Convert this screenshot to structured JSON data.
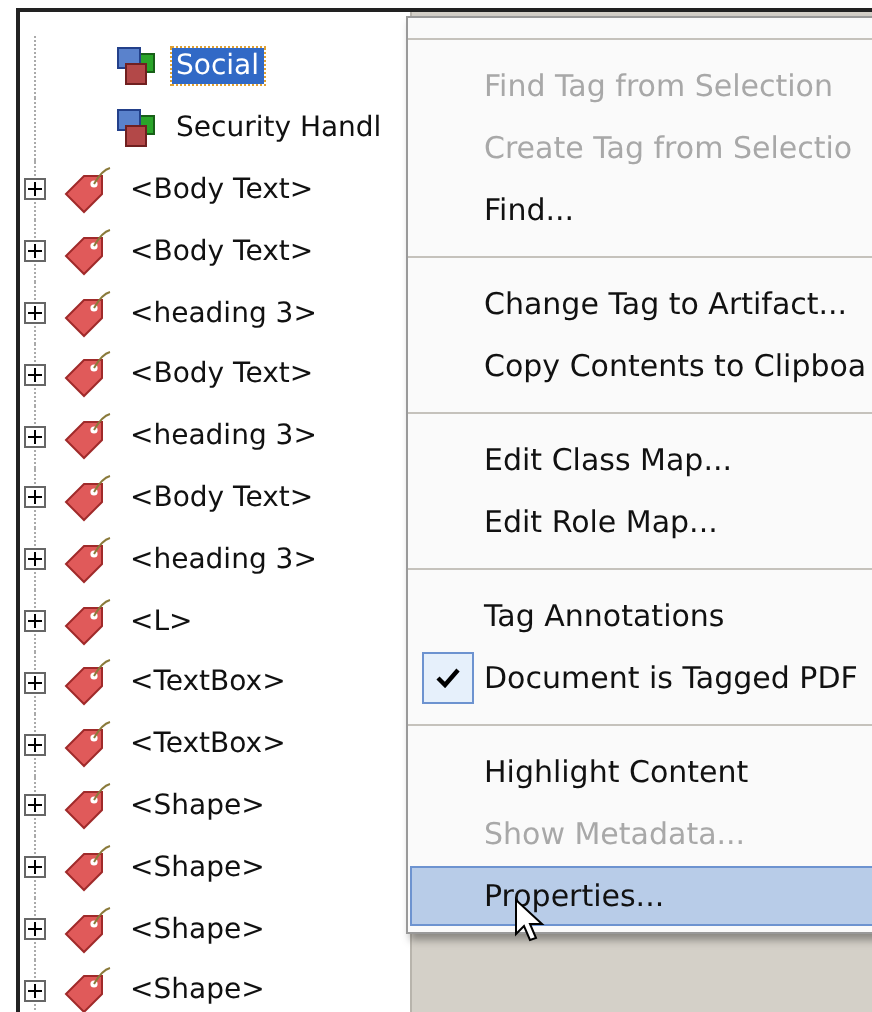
{
  "structure_items": [
    {
      "label": "Social",
      "selected": true
    },
    {
      "label": "Security Handl",
      "selected": false
    }
  ],
  "tags": [
    {
      "label": "<Body Text>",
      "expanded": false
    },
    {
      "label": "<Body Text>",
      "expanded": false
    },
    {
      "label": "<heading 3>",
      "expanded": false
    },
    {
      "label": "<Body Text>",
      "expanded": false
    },
    {
      "label": "<heading 3>",
      "expanded": false
    },
    {
      "label": "<Body Text>",
      "expanded": false
    },
    {
      "label": "<heading 3>",
      "expanded": false
    },
    {
      "label": "<L>",
      "expanded": false
    },
    {
      "label": "<TextBox>",
      "expanded": false
    },
    {
      "label": "<TextBox>",
      "expanded": false
    },
    {
      "label": "<Shape>",
      "expanded": false
    },
    {
      "label": "<Shape>",
      "expanded": false
    },
    {
      "label": "<Shape>",
      "expanded": false
    },
    {
      "label": "<Shape>",
      "expanded": false
    }
  ],
  "context_menu": [
    [
      {
        "label": "Find Tag from Selection",
        "disabled": true,
        "checked": false,
        "selected": false
      },
      {
        "label": "Create Tag from Selectio",
        "disabled": true,
        "checked": false,
        "selected": false
      },
      {
        "label": "Find...",
        "disabled": false,
        "checked": false,
        "selected": false
      }
    ],
    [
      {
        "label": "Change Tag to Artifact...",
        "disabled": false,
        "checked": false,
        "selected": false
      },
      {
        "label": "Copy Contents to Clipboa",
        "disabled": false,
        "checked": false,
        "selected": false
      }
    ],
    [
      {
        "label": "Edit Class Map...",
        "disabled": false,
        "checked": false,
        "selected": false
      },
      {
        "label": "Edit Role Map...",
        "disabled": false,
        "checked": false,
        "selected": false
      }
    ],
    [
      {
        "label": "Tag Annotations",
        "disabled": false,
        "checked": false,
        "selected": false
      },
      {
        "label": "Document is Tagged PDF",
        "disabled": false,
        "checked": true,
        "selected": false
      }
    ],
    [
      {
        "label": "Highlight Content",
        "disabled": false,
        "checked": false,
        "selected": false
      },
      {
        "label": "Show Metadata...",
        "disabled": true,
        "checked": false,
        "selected": false
      },
      {
        "label": "Properties...",
        "disabled": false,
        "checked": false,
        "selected": true
      }
    ]
  ]
}
